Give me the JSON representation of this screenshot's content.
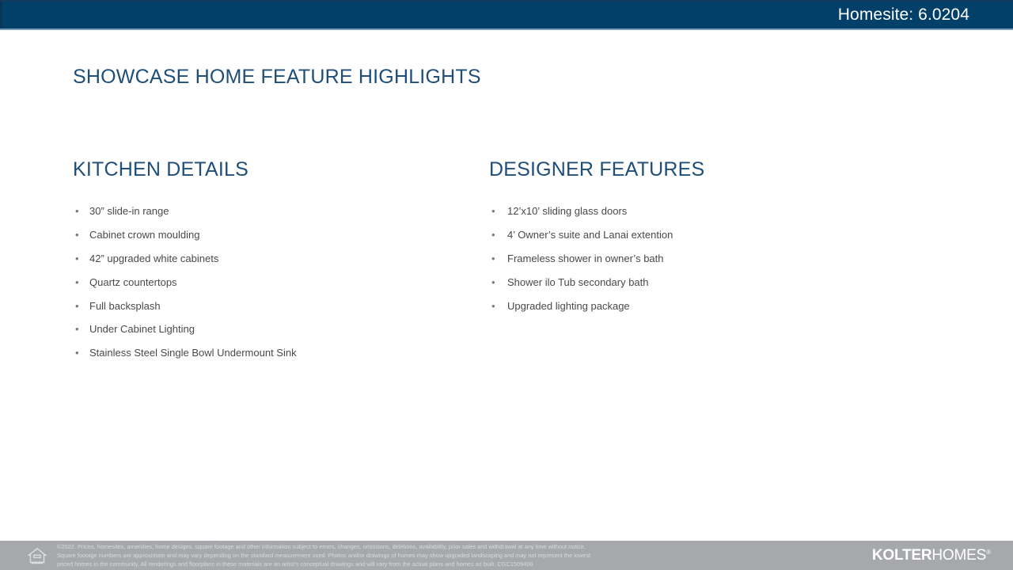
{
  "header": {
    "homesite_label": "Homesite: 6.0204",
    "background_color": "#034069",
    "text_color": "#ffffff"
  },
  "page_title": "SHOWCASE HOME FEATURE HIGHLIGHTS",
  "accent_color": "#1f4e79",
  "columns": [
    {
      "heading": "KITCHEN DETAILS",
      "bullet_glyph": "•",
      "items": [
        "30” slide-in range",
        "Cabinet crown moulding",
        "42” upgraded white cabinets",
        "Quartz countertops",
        "Full backsplash",
        "Under Cabinet Lighting",
        "Stainless Steel Single Bowl Undermount Sink"
      ]
    },
    {
      "heading": "DESIGNER FEATURES",
      "bullet_glyph": "•",
      "items": [
        "12’x10’ sliding glass doors",
        "4’ Owner’s suite and Lanai extention",
        "Frameless shower in owner’s bath",
        "Shower ilo Tub secondary bath",
        "Upgraded lighting package"
      ]
    }
  ],
  "footer": {
    "background_color": "#a6a8ab",
    "eho_icon_name": "equal-housing-opportunity-icon",
    "disclaimer_line1": "©2022. Prices, homesites, amenities, home designs, square footage and other information subject to errors, changes, omissions, deletions, availability, prior sales and withdrawal at any time without notice.",
    "disclaimer_line2": "Square footage numbers are approximate and may vary depending on the standard measurement used. Photos and/or drawings of homes may show upgraded landscaping and may not represent the lowest",
    "disclaimer_line3": "priced homes in the community. All renderings and floorplans in these materials are an artist’s conceptual drawings and will vary from the actual plans and homes as built. CGC1509406",
    "logo_bold": "KOLTER",
    "logo_light": "HOMES",
    "logo_mark": "®"
  }
}
